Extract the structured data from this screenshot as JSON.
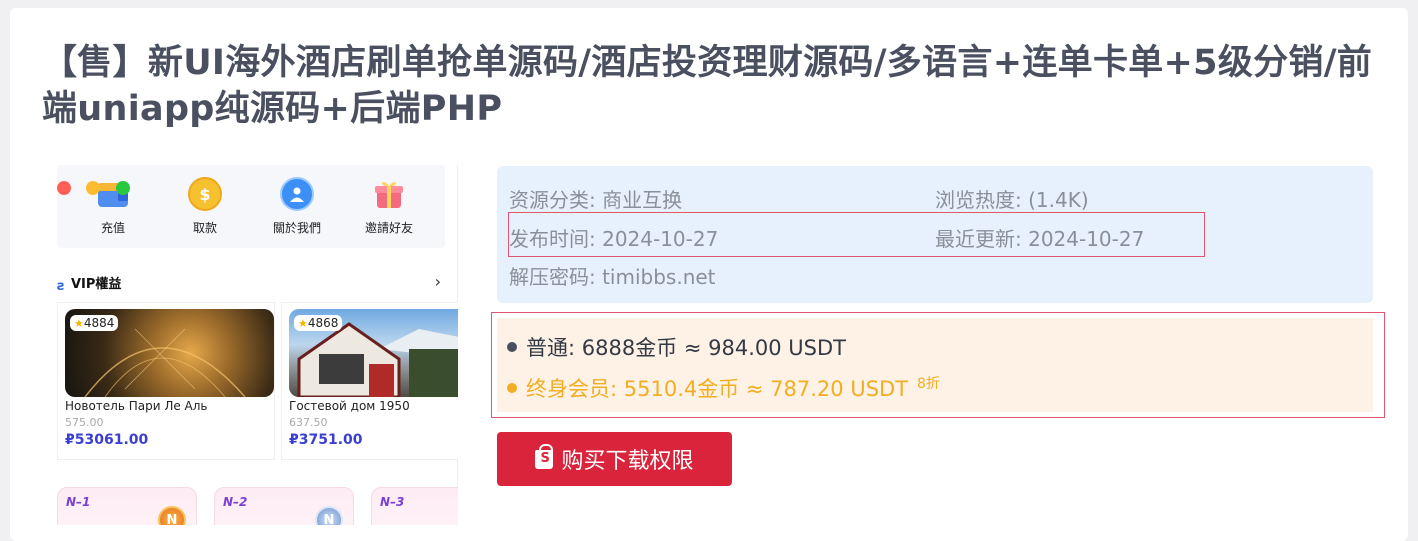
{
  "title": "【售】新UI海外酒店刷单抢单源码/酒店投资理财源码/多语言+连单卡单+5级分销/前端uniapp纯源码+后端PHP",
  "preview": {
    "menu": [
      {
        "label": "充值",
        "icon": "wallet-icon"
      },
      {
        "label": "取款",
        "icon": "coin-icon"
      },
      {
        "label": "關於我們",
        "icon": "about-icon"
      },
      {
        "label": "邀請好友",
        "icon": "gift-icon"
      }
    ],
    "vip_title": "VIP權益",
    "hotels": [
      {
        "rating": "4884",
        "name": "Новотель Пари Ле Аль",
        "sub": "575.00",
        "price": "₽53061.00"
      },
      {
        "rating": "4868",
        "name": "Гостевой дом 1950",
        "sub": "637.50",
        "price": "₽3751.00"
      }
    ],
    "levels": [
      {
        "label": "N–1",
        "medal": "N"
      },
      {
        "label": "N–2",
        "medal": "N"
      },
      {
        "label": "N–3",
        "medal": ""
      }
    ]
  },
  "info": {
    "category": "资源分类: 商业互换",
    "views": "浏览热度: (1.4K)",
    "published": "发布时间: 2024-10-27",
    "updated": "最近更新: 2024-10-27",
    "password": "解压密码: timibbs.net"
  },
  "pricing": {
    "normal": "普通: 6888金币 ≈ 984.00 USDT",
    "vip": "终身会员: 5510.4金币 ≈ 787.20 USDT",
    "discount": "8折"
  },
  "buy_button": "购买下载权限",
  "colors": {
    "accent_red": "#d9243b",
    "vip_gold": "#f1ae22",
    "info_bg": "#e6f1fd",
    "price_bg": "#fef1e6"
  }
}
